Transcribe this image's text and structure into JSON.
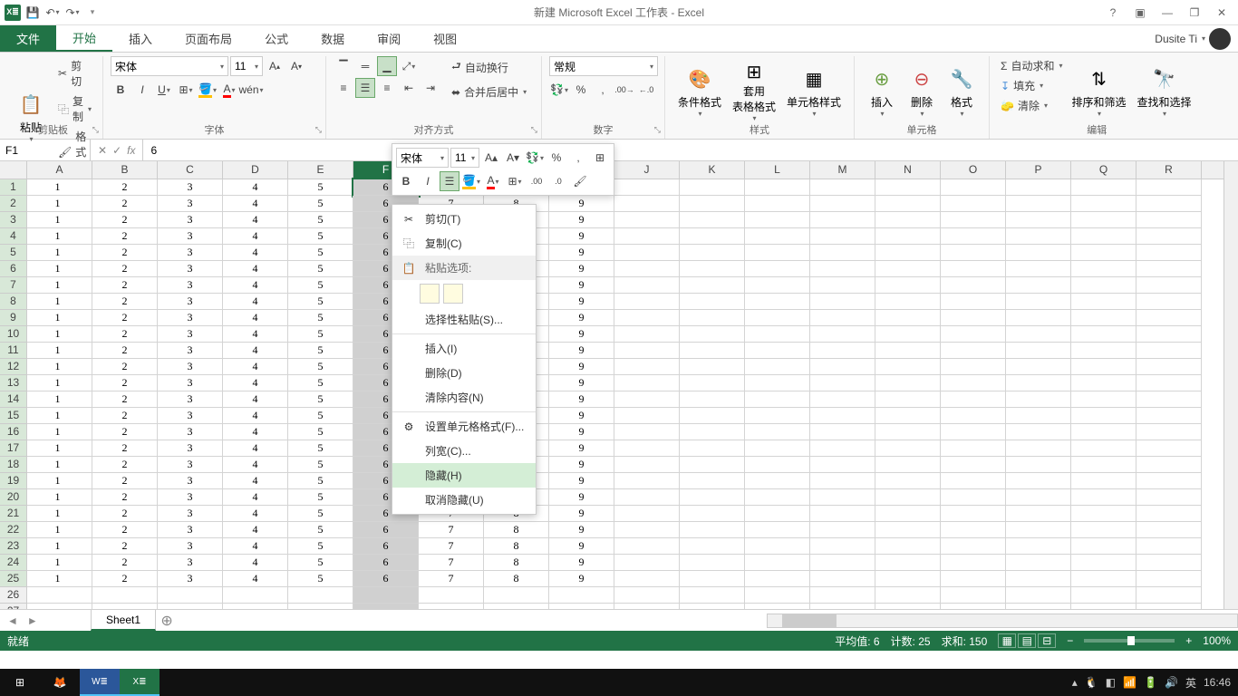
{
  "title": "新建 Microsoft Excel 工作表 - Excel",
  "user": "Dusite Ti",
  "qat": {
    "save": "💾",
    "undo": "↶",
    "redo": "↷"
  },
  "tabs": {
    "file": "文件",
    "home": "开始",
    "insert": "插入",
    "layout": "页面布局",
    "formulas": "公式",
    "data": "数据",
    "review": "审阅",
    "view": "视图"
  },
  "clipboard": {
    "paste": "粘贴",
    "cut": "剪切",
    "copy": "复制",
    "painter": "格式刷",
    "label": "剪贴板"
  },
  "font": {
    "name": "宋体",
    "size": "11",
    "label": "字体"
  },
  "align": {
    "wrap": "自动换行",
    "merge": "合并后居中",
    "label": "对齐方式"
  },
  "number": {
    "format": "常规",
    "label": "数字"
  },
  "styles": {
    "cond": "条件格式",
    "table": "套用\n表格格式",
    "cell": "单元格样式",
    "label": "样式"
  },
  "cells": {
    "insert": "插入",
    "delete": "删除",
    "format": "格式",
    "label": "单元格"
  },
  "editing": {
    "sum": "自动求和",
    "fill": "填充",
    "clear": "清除",
    "sort": "排序和筛选",
    "find": "查找和选择",
    "label": "编辑"
  },
  "namebox": "F1",
  "formula": "6",
  "columns": [
    "A",
    "B",
    "C",
    "D",
    "E",
    "F",
    "G",
    "H",
    "I",
    "J",
    "K",
    "L",
    "M",
    "N",
    "O",
    "P",
    "Q",
    "R"
  ],
  "rowvals": [
    "1",
    "2",
    "3",
    "4",
    "5",
    "6",
    "7",
    "8",
    "9"
  ],
  "numrows": 25,
  "emptyrows": 2,
  "sheet": "Sheet1",
  "status": {
    "ready": "就绪",
    "avg": "平均值: 6",
    "count": "计数: 25",
    "sum": "求和: 150",
    "zoom": "100%"
  },
  "mini": {
    "font": "宋体",
    "size": "11"
  },
  "ctx": {
    "cut": "剪切(T)",
    "copy": "复制(C)",
    "pasteopt": "粘贴选项:",
    "pastespecial": "选择性粘贴(S)...",
    "insert": "插入(I)",
    "delete": "删除(D)",
    "clear": "清除内容(N)",
    "format": "设置单元格格式(F)...",
    "colwidth": "列宽(C)...",
    "hide": "隐藏(H)",
    "unhide": "取消隐藏(U)"
  },
  "time": "16:46",
  "ime": "英"
}
